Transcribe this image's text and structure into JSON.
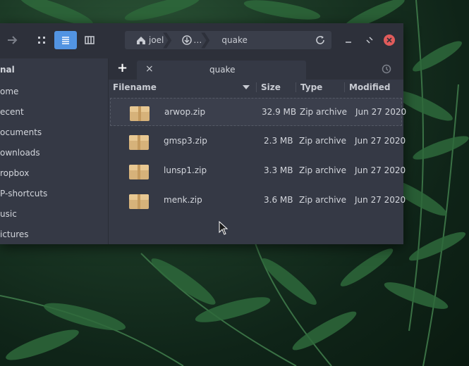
{
  "path": {
    "home": "joel",
    "mid": "…",
    "current": "quake"
  },
  "sidebar": {
    "header": "nal",
    "items": [
      {
        "label": "ome"
      },
      {
        "label": "ecent"
      },
      {
        "label": "ocuments"
      },
      {
        "label": "ownloads"
      },
      {
        "label": "ropbox"
      },
      {
        "label": "P-shortcuts"
      },
      {
        "label": "usic"
      },
      {
        "label": "ictures"
      }
    ]
  },
  "tabs": {
    "new_tab": "+",
    "close": "×",
    "active_label": "quake"
  },
  "columns": {
    "filename": "Filename",
    "size": "Size",
    "type": "Type",
    "modified": "Modified"
  },
  "files": [
    {
      "name": "arwop.zip",
      "size": "32.9 MB",
      "type": "Zip archive",
      "modified": "Jun 27 2020"
    },
    {
      "name": "gmsp3.zip",
      "size": "2.3 MB",
      "type": "Zip archive",
      "modified": "Jun 27 2020"
    },
    {
      "name": "lunsp1.zip",
      "size": "3.3 MB",
      "type": "Zip archive",
      "modified": "Jun 27 2020"
    },
    {
      "name": "menk.zip",
      "size": "3.6 MB",
      "type": "Zip archive",
      "modified": "Jun 27 2020"
    }
  ],
  "colors": {
    "accent": "#5294e2",
    "close": "#e05b5b"
  }
}
